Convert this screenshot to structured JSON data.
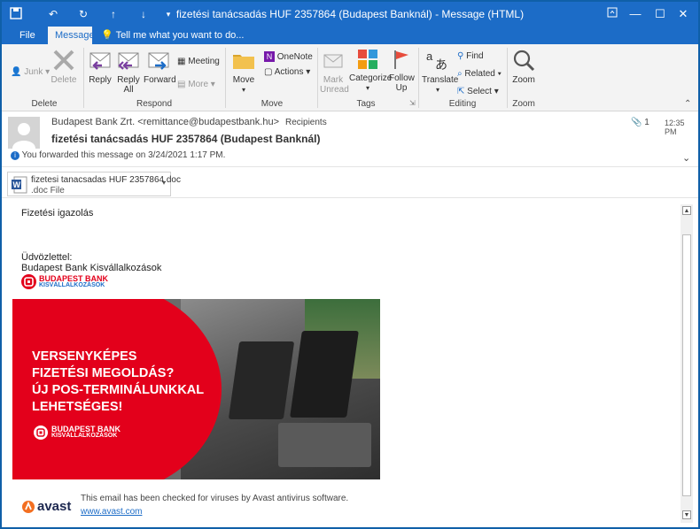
{
  "window": {
    "title": "fizetési tanácsadás HUF 2357864 (Budapest Banknál)  -  Message (HTML)"
  },
  "menu": {
    "file": "File",
    "message": "Message",
    "tell": "Tell me what you want to do..."
  },
  "ribbon": {
    "junk": "Junk",
    "delete": "Delete",
    "reply": "Reply",
    "reply_all": "Reply All",
    "forward": "Forward",
    "meeting": "Meeting",
    "more": "More",
    "move": "Move",
    "onenote": "OneNote",
    "actions": "Actions",
    "mark_unread": "Mark Unread",
    "categorize": "Categorize",
    "follow_up": "Follow Up",
    "translate": "Translate",
    "find": "Find",
    "related": "Related",
    "select": "Select",
    "zoom": "Zoom",
    "groups": {
      "delete": "Delete",
      "respond": "Respond",
      "move": "Move",
      "tags": "Tags",
      "editing": "Editing",
      "zoom": "Zoom"
    }
  },
  "message": {
    "from": "Budapest Bank Zrt. <remittance@budapestbank.hu>",
    "recipients": "Recipients",
    "attach_count": "1",
    "time": "12:35 PM",
    "subject": "fizetési tanácsadás HUF 2357864 (Budapest Banknál)",
    "forwarded": "You forwarded this message on 3/24/2021 1:17 PM."
  },
  "attachment": {
    "name": "fizetesi tanacsadas HUF 2357864.doc",
    "type": ".doc File"
  },
  "body": {
    "line1": "Fizetési igazolás",
    "greeting": "Üdvözlettel:",
    "signature": "Budapest Bank Kisvállalkozások",
    "logo_top": "BUDAPEST BANK",
    "logo_bottom": "KISVÁLLALKOZÁSOK",
    "banner_line1": "VERSENYKÉPES",
    "banner_line2": "FIZETÉSI MEGOLDÁS?",
    "banner_line3": "ÚJ POS-TERMINÁLUNKKAL",
    "banner_line4": "LEHETSÉGES!",
    "banner_logo_top": "BUDAPEST BANK",
    "banner_logo_bottom": "KISVÁLLALKOZÁSOK",
    "avast_text": "This email has been checked for viruses by Avast antivirus software.",
    "avast_link": "www.avast.com",
    "avast_brand": "avast"
  },
  "colors": {
    "accent": "#1c6cc7",
    "brand_red": "#e3001b",
    "avast_orange": "#f36f21"
  }
}
